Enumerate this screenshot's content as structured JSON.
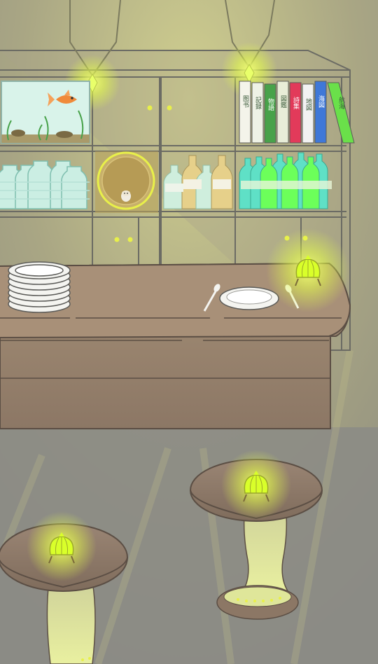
{
  "scene": {
    "name": "bar interior",
    "palette": {
      "wall_top": "#bdbd8a",
      "wall_mid": "#9d9a82",
      "floor": "#8a8a86",
      "shelf_line": "#6b6b64",
      "counter": "#9a8672",
      "counter_dark": "#7b6a5a",
      "glow": "#e8ff4a",
      "glow_core": "#d9ff2a",
      "fish": "#f08a3a",
      "bottle_teal": "#5fe0c6",
      "bottle_green": "#6cff5a",
      "plate": "#f4f4f0",
      "drum": "#b8a15a"
    }
  },
  "books": [
    {
      "color": "#f4f4ea",
      "title": "图书"
    },
    {
      "color": "#eef2e6",
      "title": "記録"
    },
    {
      "color": "#48a24a",
      "title": "物語"
    },
    {
      "color": "#e8edd8",
      "title": "図鑑"
    },
    {
      "color": "#e23a5a",
      "title": "詩集"
    },
    {
      "color": "#f2f2f2",
      "title": "地図"
    },
    {
      "color": "#3f78d8",
      "title": "海図"
    },
    {
      "color": "#6ae04a",
      "title": "航海"
    }
  ],
  "items": {
    "aquarium": "aquarium-goldfish",
    "drum": "round-drum-with-figure",
    "lamps": [
      "counter-lamp",
      "table-lamp-1",
      "table-lamp-2"
    ]
  }
}
